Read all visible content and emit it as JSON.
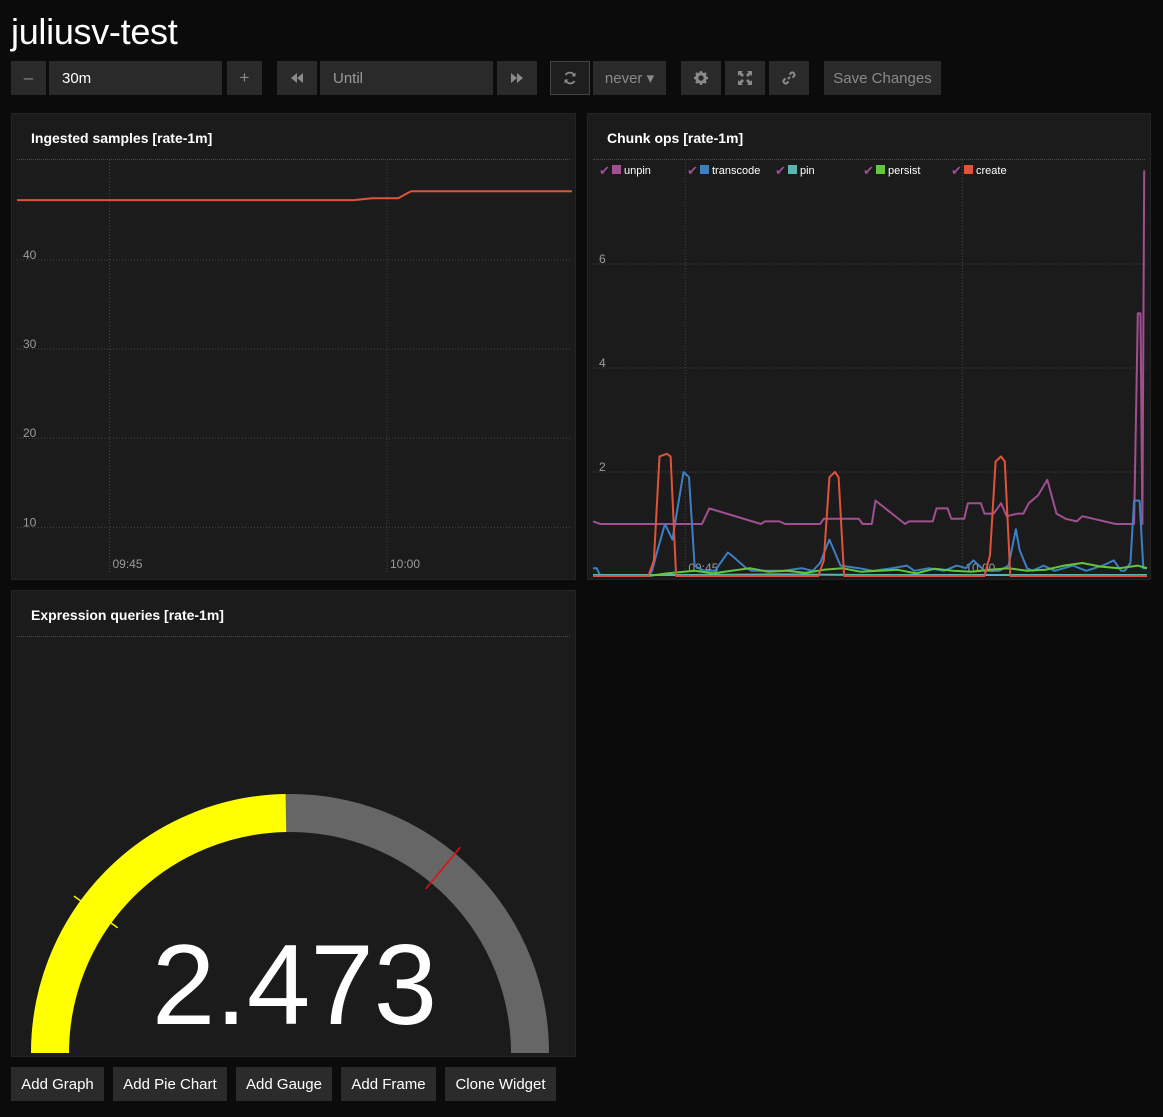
{
  "dashboard": {
    "title": "juliusv-test"
  },
  "toolbar": {
    "decrease_label": "–",
    "range_value": "30m",
    "increase_label": "+",
    "until_placeholder": "Until",
    "refresh_label": "never ▾",
    "save_label": "Save Changes",
    "icons": [
      "back-icon",
      "forward-icon",
      "refresh-icon",
      "gear-icon",
      "fullscreen-icon",
      "link-icon"
    ]
  },
  "panels": {
    "ingested": {
      "title": "Ingested samples [rate-1m]"
    },
    "chunk": {
      "title": "Chunk ops [rate-1m]"
    },
    "expression": {
      "title": "Expression queries [rate-1m]",
      "value": "2.473"
    }
  },
  "buttons": {
    "add_graph": "Add Graph",
    "add_pie_chart": "Add Pie Chart",
    "add_gauge": "Add Gauge",
    "add_frame": "Add Frame",
    "clone_widget": "Clone Widget"
  },
  "chart_data": [
    {
      "type": "line",
      "title": "Ingested samples [rate-1m]",
      "x_ticks": [
        "09:45",
        "10:00"
      ],
      "y_ticks": [
        10,
        20,
        30,
        40
      ],
      "ylim": [
        5,
        51.2
      ],
      "xlim": [
        0,
        30
      ],
      "grid": true,
      "series": [
        {
          "color": "#e0533b",
          "x": [
            0,
            18.2,
            19.2,
            20.6,
            21.3,
            30
          ],
          "y": [
            46.7,
            46.7,
            46.9,
            46.9,
            47.7,
            47.7
          ]
        }
      ]
    },
    {
      "type": "line",
      "title": "Chunk ops [rate-1m]",
      "x_ticks": [
        "09:45",
        "10:00"
      ],
      "y_ticks": [
        2,
        4,
        6
      ],
      "ylim": [
        0,
        8
      ],
      "xlim": [
        0,
        30
      ],
      "grid": true,
      "legend": "top",
      "series": [
        {
          "name": "unpin",
          "color": "#a04f91",
          "x": [
            0,
            0.4,
            5.9,
            6.3,
            9.1,
            9.3,
            10.1,
            10.4,
            11.5,
            12.3,
            12.5,
            14.4,
            14.6,
            15.1,
            15.3,
            16.9,
            17.1,
            18.4,
            18.6,
            19.2,
            19.4,
            20.1,
            20.3,
            21.0,
            21.2,
            21.7,
            22.1,
            22.4,
            23.0,
            23.3,
            23.6,
            24.1,
            24.6,
            25.1,
            25.6,
            26.2,
            26.5,
            28.3,
            28.6,
            29.3,
            29.5,
            29.65,
            29.75,
            29.85
          ],
          "y": [
            1.05,
            1.0,
            1.0,
            1.3,
            1.0,
            1.05,
            1.05,
            1.0,
            1.0,
            1.0,
            1.1,
            1.1,
            1.0,
            1.0,
            1.45,
            1.0,
            1.05,
            1.05,
            1.3,
            1.3,
            1.1,
            1.1,
            1.4,
            1.4,
            1.2,
            1.2,
            1.4,
            1.15,
            1.2,
            1.2,
            1.4,
            1.55,
            1.85,
            1.2,
            1.1,
            1.05,
            1.15,
            1.0,
            1.0,
            1.0,
            5.05,
            5.05,
            1.0,
            7.8
          ]
        },
        {
          "name": "transcode",
          "color": "#3d7fc2",
          "x": [
            0,
            0.2,
            0.4,
            3.0,
            3.2,
            3.5,
            3.9,
            4.3,
            4.9,
            5.2,
            5.5,
            6.0,
            6.3,
            6.6,
            7.3,
            7.5,
            8.3,
            8.6,
            10.3,
            11.3,
            11.9,
            12.3,
            12.8,
            13.4,
            14.4,
            15.2,
            16.2,
            17.0,
            17.4,
            18.2,
            19.0,
            19.7,
            20.2,
            20.6,
            21.2,
            22.0,
            22.5,
            22.9,
            23.1,
            23.5,
            23.8,
            24.4,
            25.0,
            26.0,
            26.7,
            27.6,
            28.2,
            28.6,
            28.8,
            29.1,
            29.3,
            29.6,
            29.8,
            30
          ],
          "y": [
            0.15,
            0.15,
            0.0,
            0.0,
            0.1,
            0.5,
            1.0,
            0.7,
            2.0,
            1.9,
            0.2,
            0.1,
            0.1,
            0.1,
            0.45,
            0.4,
            0.15,
            0.1,
            0.1,
            0.15,
            0.1,
            0.25,
            0.7,
            0.2,
            0.15,
            0.1,
            0.15,
            0.2,
            0.1,
            0.15,
            0.1,
            0.2,
            0.15,
            0.3,
            0.1,
            0.1,
            0.2,
            0.9,
            0.5,
            0.15,
            0.1,
            0.2,
            0.1,
            0.2,
            0.1,
            0.2,
            0.3,
            0.1,
            0.1,
            0.25,
            1.45,
            1.45,
            0.15,
            0.15
          ]
        },
        {
          "name": "pin",
          "color": "#5ab5b0",
          "x": [
            0,
            5,
            10,
            15,
            20,
            25,
            30
          ],
          "y": [
            0.02,
            0.02,
            0.03,
            0.02,
            0.02,
            0.02,
            0.02
          ]
        },
        {
          "name": "persist",
          "color": "#64c63d",
          "x": [
            0,
            3.0,
            4.0,
            5.5,
            6.5,
            7.5,
            8.5,
            9.5,
            10.5,
            11.5,
            12.5,
            13.5,
            14.5,
            15.5,
            16.5,
            17.5,
            18.5,
            19.5,
            20.5,
            21.5,
            22.5,
            23.5,
            24.5,
            25.5,
            26.5,
            27.5,
            28.5,
            29.5,
            30
          ],
          "y": [
            0.0,
            0.0,
            0.05,
            0.1,
            0.05,
            0.1,
            0.15,
            0.08,
            0.1,
            0.06,
            0.12,
            0.15,
            0.08,
            0.1,
            0.12,
            0.05,
            0.14,
            0.1,
            0.08,
            0.12,
            0.15,
            0.1,
            0.12,
            0.2,
            0.25,
            0.18,
            0.15,
            0.2,
            0.15
          ]
        },
        {
          "name": "create",
          "color": "#e0533b",
          "x": [
            0,
            3.0,
            3.3,
            3.6,
            4.0,
            4.2,
            4.5,
            12.2,
            12.5,
            12.8,
            13.1,
            13.3,
            13.6,
            21.2,
            21.5,
            21.8,
            22.1,
            22.3,
            22.6,
            30
          ],
          "y": [
            0.0,
            0.0,
            0.3,
            2.3,
            2.35,
            2.3,
            0.0,
            0.0,
            0.3,
            1.9,
            2.0,
            1.9,
            0.0,
            0.0,
            0.4,
            2.2,
            2.3,
            2.2,
            0.0,
            0.0
          ]
        }
      ]
    }
  ],
  "gauge": {
    "value": 2.473,
    "min": 0,
    "max": 5,
    "threshold_yellow": 1,
    "threshold_red": 3.6,
    "fill_color": "#ffff00",
    "track_color": "#666666"
  }
}
